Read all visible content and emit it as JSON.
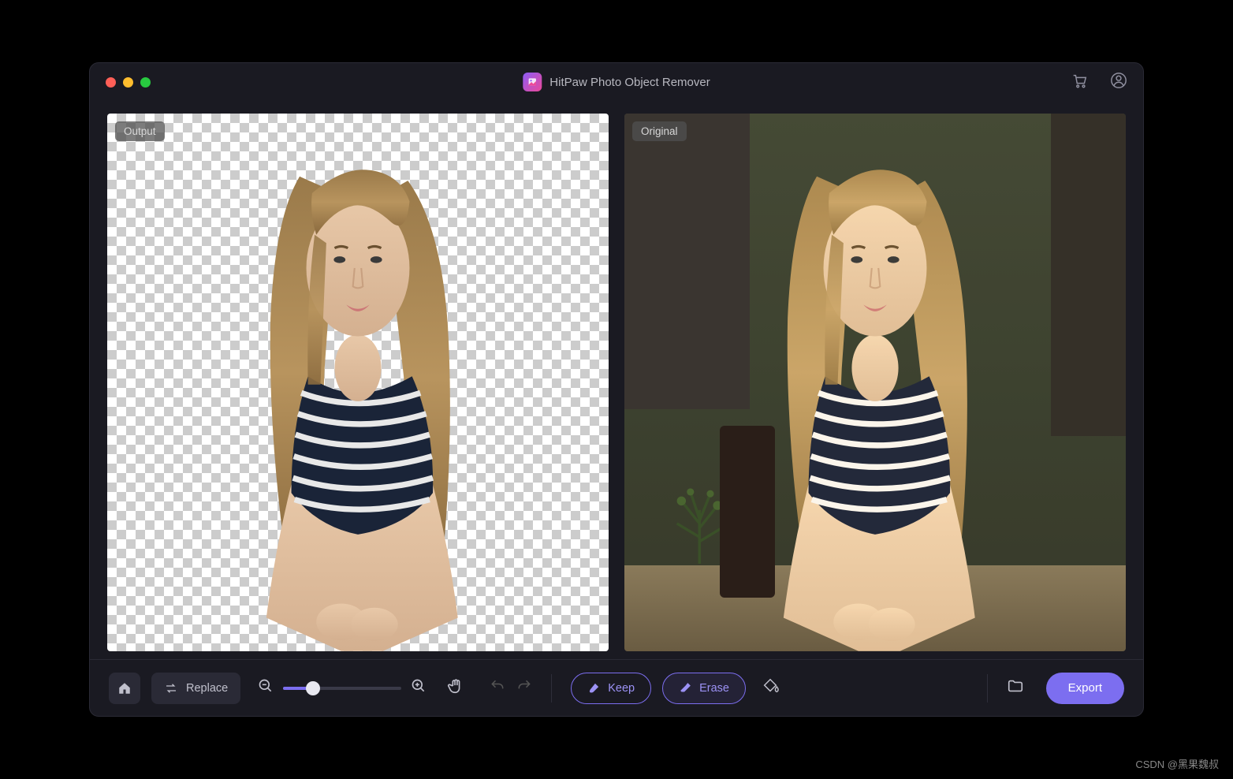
{
  "header": {
    "title": "HitPaw Photo Object Remover"
  },
  "panels": {
    "left_label": "Output",
    "right_label": "Original"
  },
  "toolbar": {
    "replace_label": "Replace",
    "keep_label": "Keep",
    "erase_label": "Erase",
    "export_label": "Export",
    "zoom_percent": 25
  },
  "watermark": "CSDN @黑果魏叔",
  "colors": {
    "accent": "#7c6ef0"
  }
}
